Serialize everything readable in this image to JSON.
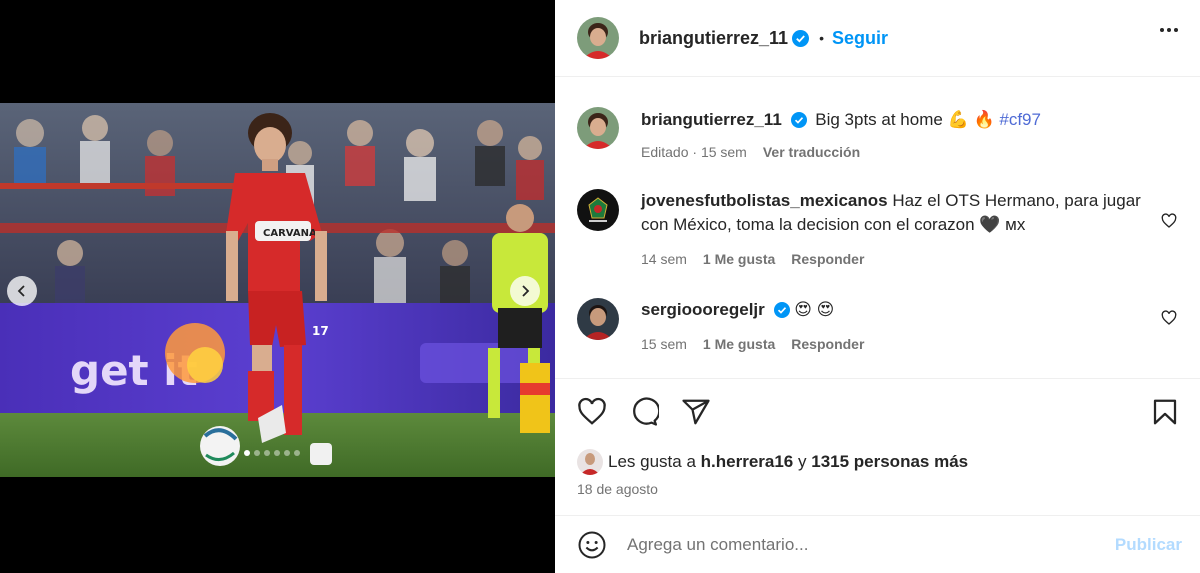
{
  "post": {
    "author": "briangutierrez_11",
    "follow_label": "Seguir",
    "separator": "•"
  },
  "caption": {
    "author": "briangutierrez_11",
    "text": "Big 3pts at home",
    "emojis": "💪 🔥",
    "hashtag": "#cf97",
    "edited": "Editado",
    "time": "15 sem",
    "translate": "Ver traducción",
    "dot": "·"
  },
  "comments": [
    {
      "author": "jovenesfutbolistas_mexicanos",
      "text": "Haz el OTS Hermano, para jugar con México, toma la decision con el corazon 🖤 мх",
      "time": "14 sem",
      "likes": "1 Me gusta",
      "reply": "Responder"
    },
    {
      "author": "sergioooregeljr",
      "text": "😍 😍",
      "time": "15 sem",
      "likes": "1 Me gusta",
      "reply": "Responder"
    }
  ],
  "likes": {
    "prefix": "Les gusta a",
    "user": "h.herrera16",
    "conj": "y",
    "others": "1315 personas más"
  },
  "date": "18 de agosto",
  "add_comment": {
    "placeholder": "Agrega un comentario...",
    "publish": "Publicar"
  },
  "carousel": {
    "total": 6,
    "active": 1
  },
  "photo": {
    "jersey_sponsor": "CARVANA",
    "jersey_number": "17",
    "board_text": "get it"
  },
  "colors": {
    "accent": "#0095f6",
    "verified": "#0095f6",
    "hashtag": "#4f6bd5",
    "publish_disabled": "#b3dbff",
    "jersey": "#d62a2a"
  },
  "icons": {
    "like": "heart-outline-icon",
    "comment": "speech-bubble-icon",
    "share": "paper-plane-icon",
    "save": "bookmark-icon",
    "more": "three-dots-icon",
    "emoji": "smiley-icon"
  }
}
